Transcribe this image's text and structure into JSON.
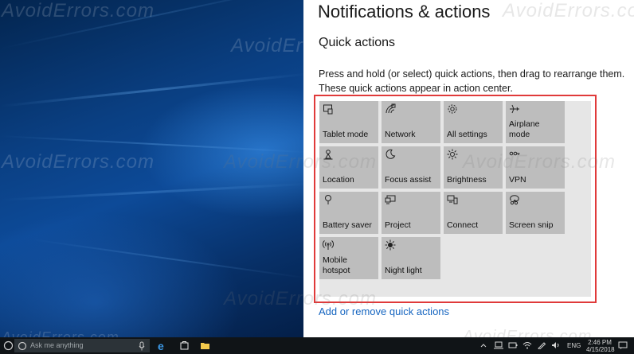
{
  "settings": {
    "page_title": "Notifications & actions",
    "section_title": "Quick actions",
    "description": "Press and hold (or select) quick actions, then drag to rearrange them. These quick actions appear in action center.",
    "tiles": [
      {
        "label": "Tablet mode",
        "icon": "tablet-mode-icon"
      },
      {
        "label": "Network",
        "icon": "network-icon"
      },
      {
        "label": "All settings",
        "icon": "gear-icon"
      },
      {
        "label": "Airplane mode",
        "icon": "airplane-icon"
      },
      {
        "label": "Location",
        "icon": "location-icon"
      },
      {
        "label": "Focus assist",
        "icon": "moon-icon"
      },
      {
        "label": "Brightness",
        "icon": "brightness-icon"
      },
      {
        "label": "VPN",
        "icon": "vpn-icon"
      },
      {
        "label": "Battery saver",
        "icon": "battery-saver-icon"
      },
      {
        "label": "Project",
        "icon": "project-icon"
      },
      {
        "label": "Connect",
        "icon": "connect-icon"
      },
      {
        "label": "Screen snip",
        "icon": "screen-snip-icon"
      },
      {
        "label": "Mobile\nhotspot",
        "icon": "mobile-hotspot-icon"
      },
      {
        "label": "Night light",
        "icon": "night-light-icon"
      }
    ],
    "add_remove_link": "Add or remove quick actions"
  },
  "watermark": "AvoidErrors.com",
  "taskbar": {
    "search_placeholder": "Ask me anything",
    "language": "ENG",
    "time": "2:46 PM",
    "date": "4/15/2018"
  },
  "colors": {
    "accent_link": "#1565c0",
    "highlight_border": "#e03a3a",
    "tile_bg": "#bdbdbd",
    "tiles_area_bg": "#e6e6e6"
  }
}
